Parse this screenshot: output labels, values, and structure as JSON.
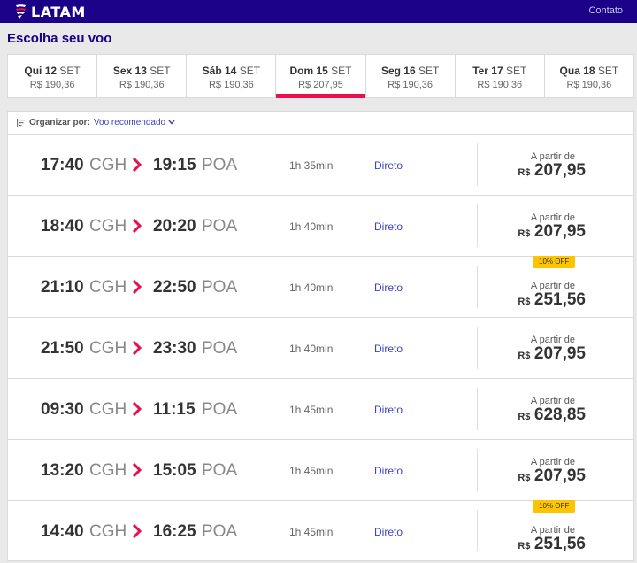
{
  "header": {
    "logo_text": "LATAM",
    "contact_label": "Contato",
    "brand_color": "#1b0088",
    "accent_color": "#e8114b"
  },
  "page_title": "Escolha seu voo",
  "date_tabs": [
    {
      "day": "Qui 12",
      "month": "SET",
      "price": "R$ 190,36"
    },
    {
      "day": "Sex 13",
      "month": "SET",
      "price": "R$ 190,36"
    },
    {
      "day": "Sáb 14",
      "month": "SET",
      "price": "R$ 190,36"
    },
    {
      "day": "Dom 15",
      "month": "SET",
      "price": "R$ 207,95",
      "active": true
    },
    {
      "day": "Seg 16",
      "month": "SET",
      "price": "R$ 190,36"
    },
    {
      "day": "Ter 17",
      "month": "SET",
      "price": "R$ 190,36"
    },
    {
      "day": "Qua 18",
      "month": "SET",
      "price": "R$ 190,36"
    }
  ],
  "sort": {
    "label": "Organizar por:",
    "value": "Voo recomendado"
  },
  "flights": [
    {
      "dep_time": "17:40",
      "dep_airport": "CGH",
      "arr_time": "19:15",
      "arr_airport": "POA",
      "duration": "1h 35min",
      "stops": "Direto",
      "from_label": "A partir de",
      "currency": "R$",
      "price": "207,95",
      "badge": ""
    },
    {
      "dep_time": "18:40",
      "dep_airport": "CGH",
      "arr_time": "20:20",
      "arr_airport": "POA",
      "duration": "1h 40min",
      "stops": "Direto",
      "from_label": "A partir de",
      "currency": "R$",
      "price": "207,95",
      "badge": ""
    },
    {
      "dep_time": "21:10",
      "dep_airport": "CGH",
      "arr_time": "22:50",
      "arr_airport": "POA",
      "duration": "1h 40min",
      "stops": "Direto",
      "from_label": "A partir de",
      "currency": "R$",
      "price": "251,56",
      "badge": "10% OFF"
    },
    {
      "dep_time": "21:50",
      "dep_airport": "CGH",
      "arr_time": "23:30",
      "arr_airport": "POA",
      "duration": "1h 40min",
      "stops": "Direto",
      "from_label": "A partir de",
      "currency": "R$",
      "price": "207,95",
      "badge": ""
    },
    {
      "dep_time": "09:30",
      "dep_airport": "CGH",
      "arr_time": "11:15",
      "arr_airport": "POA",
      "duration": "1h 45min",
      "stops": "Direto",
      "from_label": "A partir de",
      "currency": "R$",
      "price": "628,85",
      "badge": ""
    },
    {
      "dep_time": "13:20",
      "dep_airport": "CGH",
      "arr_time": "15:05",
      "arr_airport": "POA",
      "duration": "1h 45min",
      "stops": "Direto",
      "from_label": "A partir de",
      "currency": "R$",
      "price": "207,95",
      "badge": ""
    },
    {
      "dep_time": "14:40",
      "dep_airport": "CGH",
      "arr_time": "16:25",
      "arr_airport": "POA",
      "duration": "1h 45min",
      "stops": "Direto",
      "from_label": "A partir de",
      "currency": "R$",
      "price": "251,56",
      "badge": "10% OFF"
    }
  ]
}
